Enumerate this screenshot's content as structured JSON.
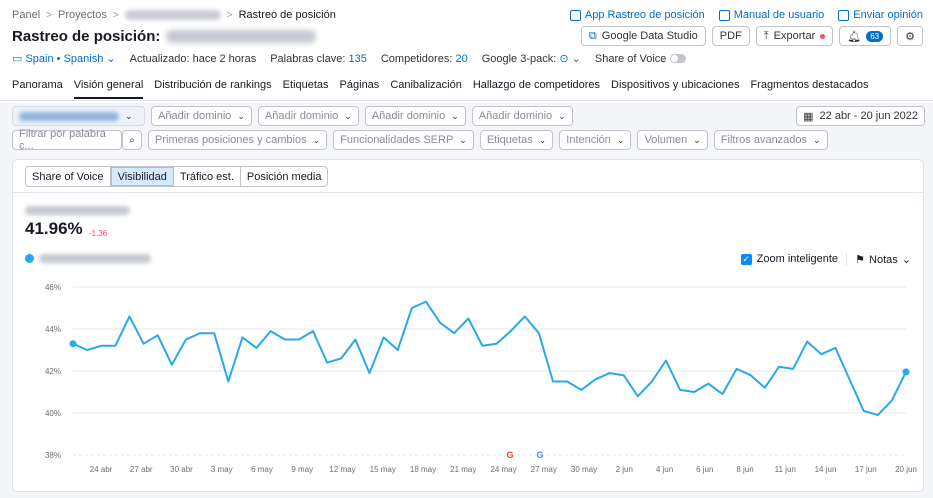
{
  "breadcrumb": {
    "items": [
      "Panel",
      "Proyectos"
    ],
    "current": "Rastreo de posición"
  },
  "top_links": {
    "app": "App Rastreo de posición",
    "manual": "Manual de usuario",
    "feedback": "Enviar opinión"
  },
  "header": {
    "title": "Rastreo de posición:"
  },
  "actions": {
    "gds": "Google Data Studio",
    "pdf": "PDF",
    "export": "Exportar",
    "notif_count": "63"
  },
  "meta": {
    "locale": "Spain • Spanish",
    "updated": "Actualizado: hace 2 horas",
    "keywords_label": "Palabras clave:",
    "keywords_value": "135",
    "competitors_label": "Competidores:",
    "competitors_value": "20",
    "pack_label": "Google 3-pack:",
    "sov_label": "Share of Voice"
  },
  "tabs": [
    "Panorama",
    "Visión general",
    "Distribución de rankings",
    "Etiquetas",
    "Páginas",
    "Canibalización",
    "Hallazgo de competidores",
    "Dispositivos y ubicaciones",
    "Fragmentos destacados"
  ],
  "active_tab": "Visión general",
  "filters": {
    "add_domain": "Añadir dominio",
    "date_range": "22 abr - 20 jun 2022",
    "search_placeholder": "Filtrar por palabra c...",
    "dropdowns": [
      "Primeras posiciones y cambios",
      "Funcionalidades SERP",
      "Etiquetas",
      "Intención",
      "Volumen",
      "Filtros avanzados"
    ]
  },
  "segments": [
    "Share of Voice",
    "Visibilidad",
    "Tráfico est.",
    "Posición media"
  ],
  "active_segment": "Visibilidad",
  "summary": {
    "value": "41.96%",
    "delta": "-1.36"
  },
  "controls": {
    "zoom": "Zoom inteligente",
    "notes": "Notas"
  },
  "colors": {
    "line": "#28a9eb",
    "accent": "#006dca",
    "negative": "#ff4953"
  },
  "chart_data": {
    "type": "line",
    "ylim": [
      38,
      46
    ],
    "yticks": [
      "46%",
      "44%",
      "42%",
      "40%",
      "38%"
    ],
    "xticks": [
      "24 abr",
      "27 abr",
      "30 abr",
      "3 may",
      "6 may",
      "9 may",
      "12 may",
      "15 may",
      "18 may",
      "21 may",
      "24 may",
      "27 may",
      "30 may",
      "2 jun",
      "4 jun",
      "6 jun",
      "8 jun",
      "11 jun",
      "14 jun",
      "17 jun",
      "20 jun"
    ],
    "grid": true,
    "series": [
      {
        "values": [
          43.3,
          43.0,
          43.2,
          43.2,
          44.6,
          43.3,
          43.7,
          42.3,
          43.5,
          43.8,
          43.8,
          41.5,
          43.6,
          43.1,
          43.9,
          43.5,
          43.5,
          43.9,
          42.4,
          42.6,
          43.5,
          41.9,
          43.6,
          43.0,
          45.0,
          45.3,
          44.3,
          43.8,
          44.5,
          43.2,
          43.3,
          43.9,
          44.6,
          43.8,
          41.5,
          41.5,
          41.1,
          41.6,
          41.9,
          41.8,
          40.8,
          41.5,
          42.5,
          41.1,
          41.0,
          41.4,
          40.9,
          42.1,
          41.8,
          41.2,
          42.2,
          42.1,
          43.4,
          42.8,
          43.1,
          41.6,
          40.1,
          39.9,
          40.6,
          41.96
        ]
      }
    ],
    "annotation_markers": [
      {
        "x": "23 may",
        "label": "G"
      },
      {
        "x": "24 may",
        "label": "G"
      }
    ]
  }
}
